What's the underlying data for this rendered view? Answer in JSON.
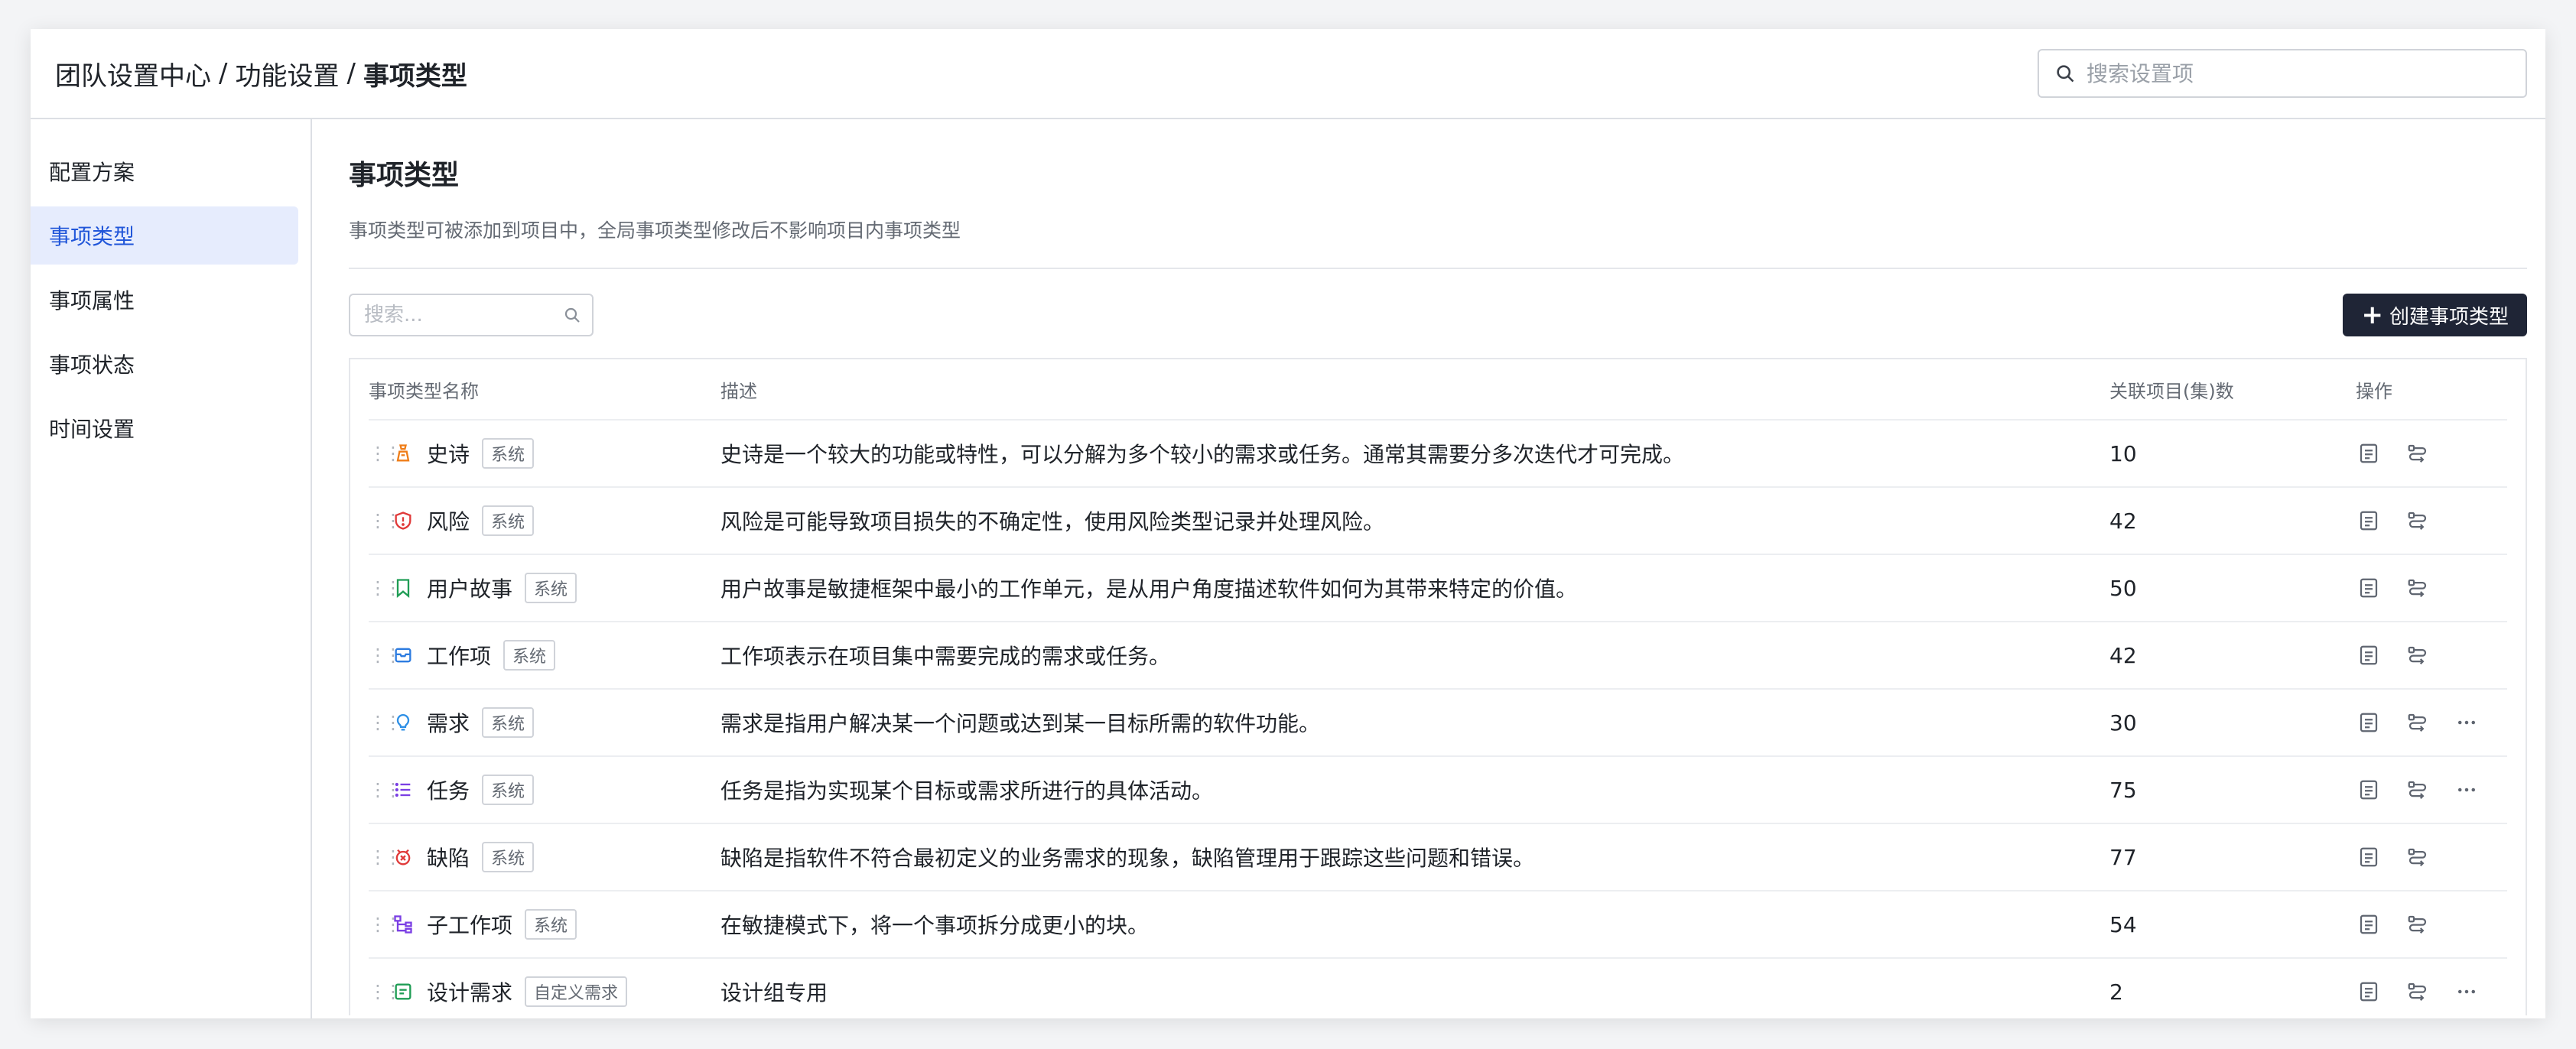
{
  "header": {
    "breadcrumb": [
      "团队设置中心",
      "功能设置",
      "事项类型"
    ],
    "separator": "/",
    "search_placeholder": "搜索设置项"
  },
  "sidebar": {
    "items": [
      {
        "label": "配置方案",
        "active": false
      },
      {
        "label": "事项类型",
        "active": true
      },
      {
        "label": "事项属性",
        "active": false
      },
      {
        "label": "事项状态",
        "active": false
      },
      {
        "label": "时间设置",
        "active": false
      }
    ]
  },
  "main": {
    "title": "事项类型",
    "description": "事项类型可被添加到项目中，全局事项类型修改后不影响项目内事项类型",
    "search_placeholder": "搜索...",
    "create_button": "创建事项类型",
    "columns": [
      "事项类型名称",
      "描述",
      "关联项目(集)数",
      "操作"
    ],
    "rows": [
      {
        "name": "史诗",
        "badge": "系统",
        "icon": "epic-icon",
        "color": "#ef7d18",
        "desc": "史诗是一个较大的功能或特性，可以分解为多个较小的需求或任务。通常其需要分多次迭代才可完成。",
        "count": "10",
        "more": false
      },
      {
        "name": "风险",
        "badge": "系统",
        "icon": "risk-icon",
        "color": "#e03a3a",
        "desc": "风险是可能导致项目损失的不确定性，使用风险类型记录并处理风险。",
        "count": "42",
        "more": false
      },
      {
        "name": "用户故事",
        "badge": "系统",
        "icon": "story-icon",
        "color": "#1f9d55",
        "desc": "用户故事是敏捷框架中最小的工作单元，是从用户角度描述软件如何为其带来特定的价值。",
        "count": "50",
        "more": false
      },
      {
        "name": "工作项",
        "badge": "系统",
        "icon": "workitem-icon",
        "color": "#2d7ce0",
        "desc": "工作项表示在项目集中需要完成的需求或任务。",
        "count": "42",
        "more": false
      },
      {
        "name": "需求",
        "badge": "系统",
        "icon": "requirement-icon",
        "color": "#2d8fe6",
        "desc": "需求是指用户解决某一个问题或达到某一目标所需的软件功能。",
        "count": "30",
        "more": true
      },
      {
        "name": "任务",
        "badge": "系统",
        "icon": "task-icon",
        "color": "#7b3fe4",
        "desc": "任务是指为实现某个目标或需求所进行的具体活动。",
        "count": "75",
        "more": true
      },
      {
        "name": "缺陷",
        "badge": "系统",
        "icon": "bug-icon",
        "color": "#e03a3a",
        "desc": "缺陷是指软件不符合最初定义的业务需求的现象，缺陷管理用于跟踪这些问题和错误。",
        "count": "77",
        "more": false
      },
      {
        "name": "子工作项",
        "badge": "系统",
        "icon": "subitem-icon",
        "color": "#7b3fe4",
        "desc": "在敏捷模式下，将一个事项拆分成更小的块。",
        "count": "54",
        "more": false
      },
      {
        "name": "设计需求",
        "badge": "自定义需求",
        "icon": "design-icon",
        "color": "#1f9d55",
        "desc": "设计组专用",
        "count": "2",
        "more": true
      }
    ]
  }
}
